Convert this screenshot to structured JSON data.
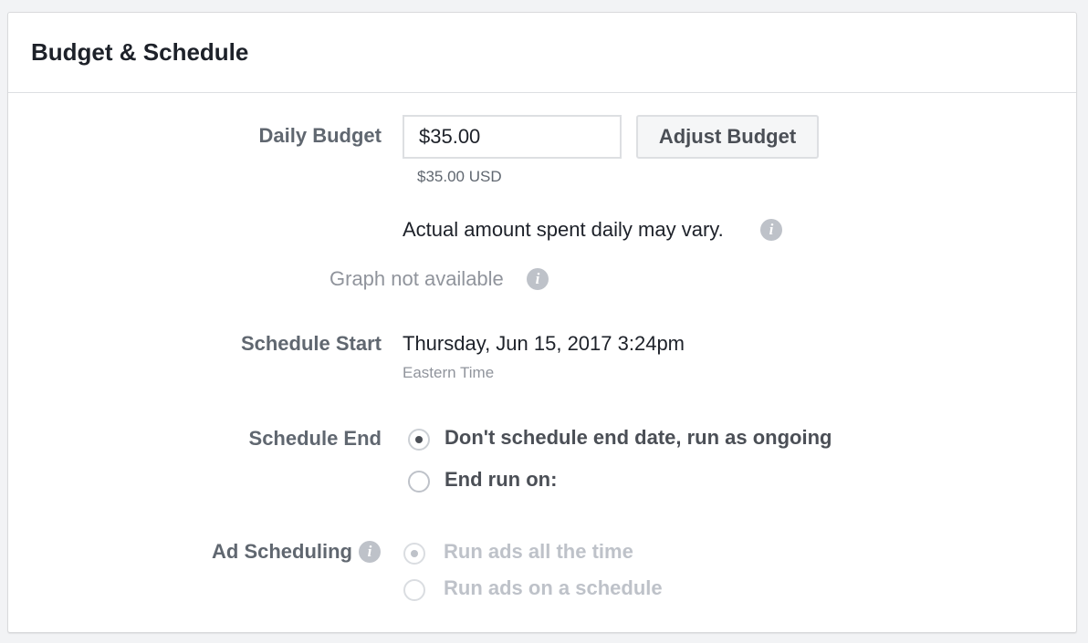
{
  "section": {
    "title": "Budget & Schedule"
  },
  "daily_budget": {
    "label": "Daily Budget",
    "value": "$35.00",
    "adjust_button": "Adjust Budget",
    "converted": "$35.00 USD",
    "note": "Actual amount spent daily may vary."
  },
  "graph": {
    "text": "Graph not available"
  },
  "schedule_start": {
    "label": "Schedule Start",
    "datetime": "Thursday, Jun 15, 2017 3:24pm",
    "timezone": "Eastern Time"
  },
  "schedule_end": {
    "label": "Schedule End",
    "options": [
      {
        "label": "Don't schedule end date, run as ongoing",
        "selected": true
      },
      {
        "label": "End run on:",
        "selected": false
      }
    ]
  },
  "ad_scheduling": {
    "label": "Ad Scheduling",
    "options": [
      {
        "label": "Run ads all the time",
        "selected": true,
        "disabled": true
      },
      {
        "label": "Run ads on a schedule",
        "selected": false,
        "disabled": true
      }
    ]
  },
  "icons": {
    "info": "info-icon",
    "radio": "radio-icon"
  },
  "colors": {
    "label_gray": "#606770",
    "disabled_gray": "#bec2c9",
    "text_dark": "#1d2129",
    "border": "#dddfe2"
  }
}
